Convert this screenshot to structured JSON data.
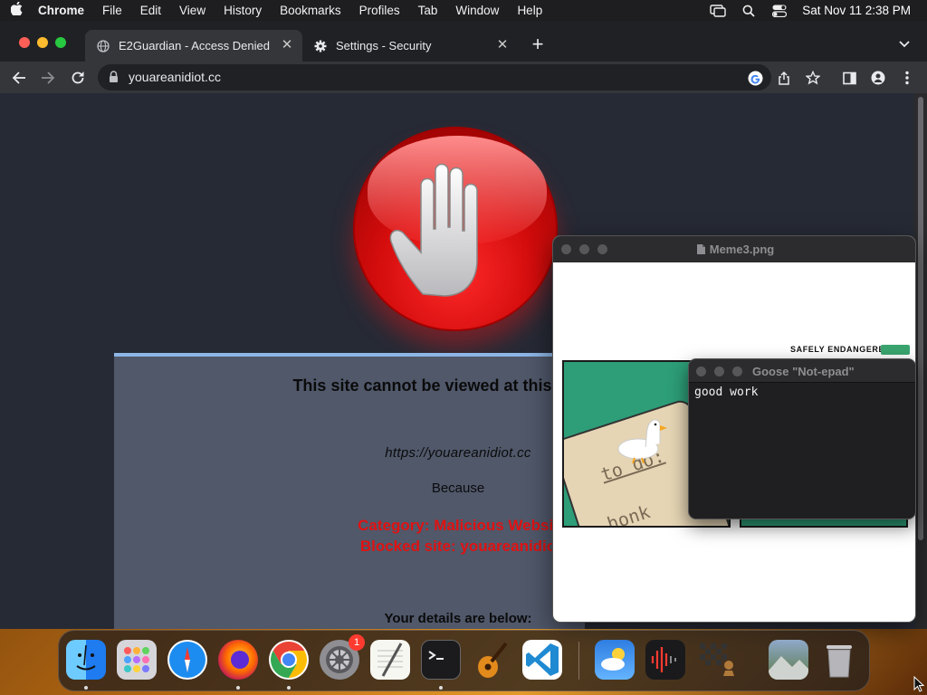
{
  "menubar": {
    "app": "Chrome",
    "items": [
      "File",
      "Edit",
      "View",
      "History",
      "Bookmarks",
      "Profiles",
      "Tab",
      "Window",
      "Help"
    ],
    "clock": "Sat Nov 11  2:38 PM",
    "status_icons": [
      "screen-mirroring-icon",
      "spotlight-search-icon",
      "control-center-icon"
    ]
  },
  "browser": {
    "tabs": [
      {
        "title": "E2Guardian - Access Denied",
        "icon": "globe-icon",
        "active": true
      },
      {
        "title": "Settings - Security",
        "icon": "gear-icon",
        "active": false
      }
    ],
    "url": "youareanidiot.cc"
  },
  "page": {
    "title": "This site cannot be viewed at this time, rea",
    "blocked_url": "https://youareanidiot.cc",
    "because": "Because",
    "category": "Category: Malicious Websit",
    "blocked_site": "Blocked site: youareanidio",
    "details": "Your details are below:"
  },
  "meme_window": {
    "title": "Meme3.png",
    "brand": "SAFELY ENDANGERED",
    "todo_text": "to do:",
    "honk_text": "honk"
  },
  "notepad_window": {
    "title": "Goose \"Not-epad\"",
    "text": "good work"
  },
  "dock": {
    "apps": [
      "Finder",
      "Launchpad",
      "Safari",
      "Firefox",
      "Chrome",
      "System Settings",
      "TextEdit",
      "Terminal",
      "GarageBand",
      "Visual Studio Code",
      "Weather",
      "Voice Memos",
      "Chess",
      "Photos",
      "Trash"
    ],
    "settings_badge": "1"
  },
  "colors": {
    "page_bg": "#262a35",
    "panel_bg": "#50586a",
    "panel_border": "#8db6e6",
    "error_red": "#e01212",
    "stop_red": "#d30c0c"
  }
}
